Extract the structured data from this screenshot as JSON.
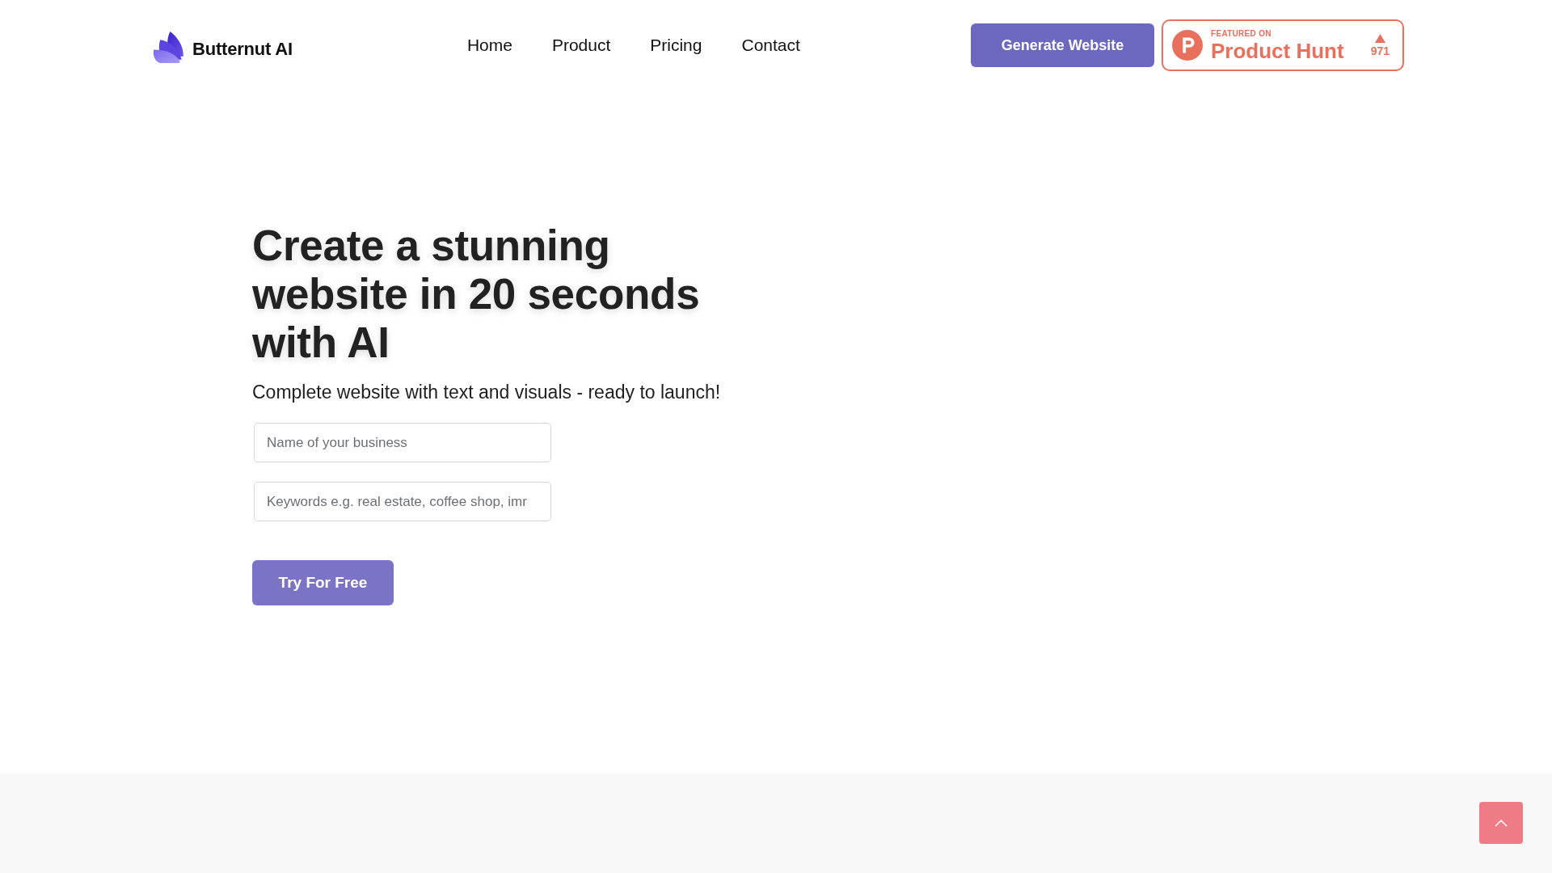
{
  "header": {
    "logo": {
      "name": "Butternut AI"
    },
    "nav": [
      {
        "label": "Home"
      },
      {
        "label": "Product"
      },
      {
        "label": "Pricing"
      },
      {
        "label": "Contact"
      }
    ],
    "generate_button": "Generate Website",
    "product_hunt_badge": {
      "caption": "FEATURED ON",
      "name": "Product Hunt",
      "votes": "971"
    }
  },
  "hero": {
    "title": "Create a stunning website in 20 seconds with AI",
    "subtitle": "Complete website with text and visuals - ready to launch!",
    "fields": [
      {
        "placeholder": "Name of your business"
      },
      {
        "placeholder": "Keywords e.g. real estate, coffee shop, imr"
      }
    ],
    "cta": "Try For Free"
  }
}
